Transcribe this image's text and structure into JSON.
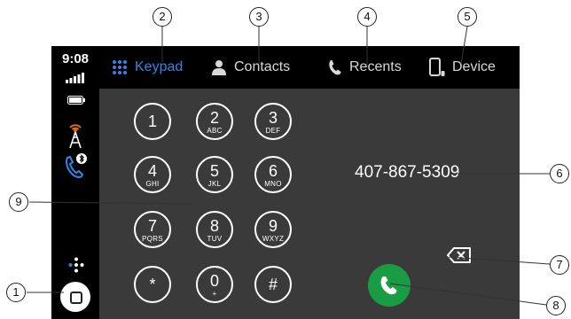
{
  "status": {
    "time": "9:08"
  },
  "icons": {
    "signal": "signal-strength-icon",
    "battery": "battery-icon",
    "tower": "cell-tower-icon",
    "phone_bluetooth": "bluetooth-phone-icon",
    "apps": "app-launcher-dots-icon",
    "home": "home-square-icon"
  },
  "tabs": [
    {
      "label": "Keypad",
      "icon": "keypad-grid-icon",
      "active": true
    },
    {
      "label": "Contacts",
      "icon": "person-icon",
      "active": false
    },
    {
      "label": "Recents",
      "icon": "phone-handset-icon",
      "active": false
    },
    {
      "label": "Device",
      "icon": "mobile-device-icon",
      "active": false
    }
  ],
  "keypad": [
    {
      "digit": "1",
      "letters": ""
    },
    {
      "digit": "2",
      "letters": "ABC"
    },
    {
      "digit": "3",
      "letters": "DEF"
    },
    {
      "digit": "4",
      "letters": "GHI"
    },
    {
      "digit": "5",
      "letters": "JKL"
    },
    {
      "digit": "6",
      "letters": "MNO"
    },
    {
      "digit": "7",
      "letters": "PQRS"
    },
    {
      "digit": "8",
      "letters": "TUV"
    },
    {
      "digit": "9",
      "letters": "WXYZ"
    },
    {
      "digit": "*",
      "letters": ""
    },
    {
      "digit": "0",
      "letters": "+"
    },
    {
      "digit": "#",
      "letters": ""
    }
  ],
  "dialer": {
    "number": "407-867-5309"
  },
  "callouts": [
    "1",
    "2",
    "3",
    "4",
    "5",
    "6",
    "7",
    "8",
    "9"
  ],
  "colors": {
    "accent": "#2f86e8",
    "call": "#1a9c45",
    "background": "#3a3a3a",
    "bars": "#000000"
  }
}
